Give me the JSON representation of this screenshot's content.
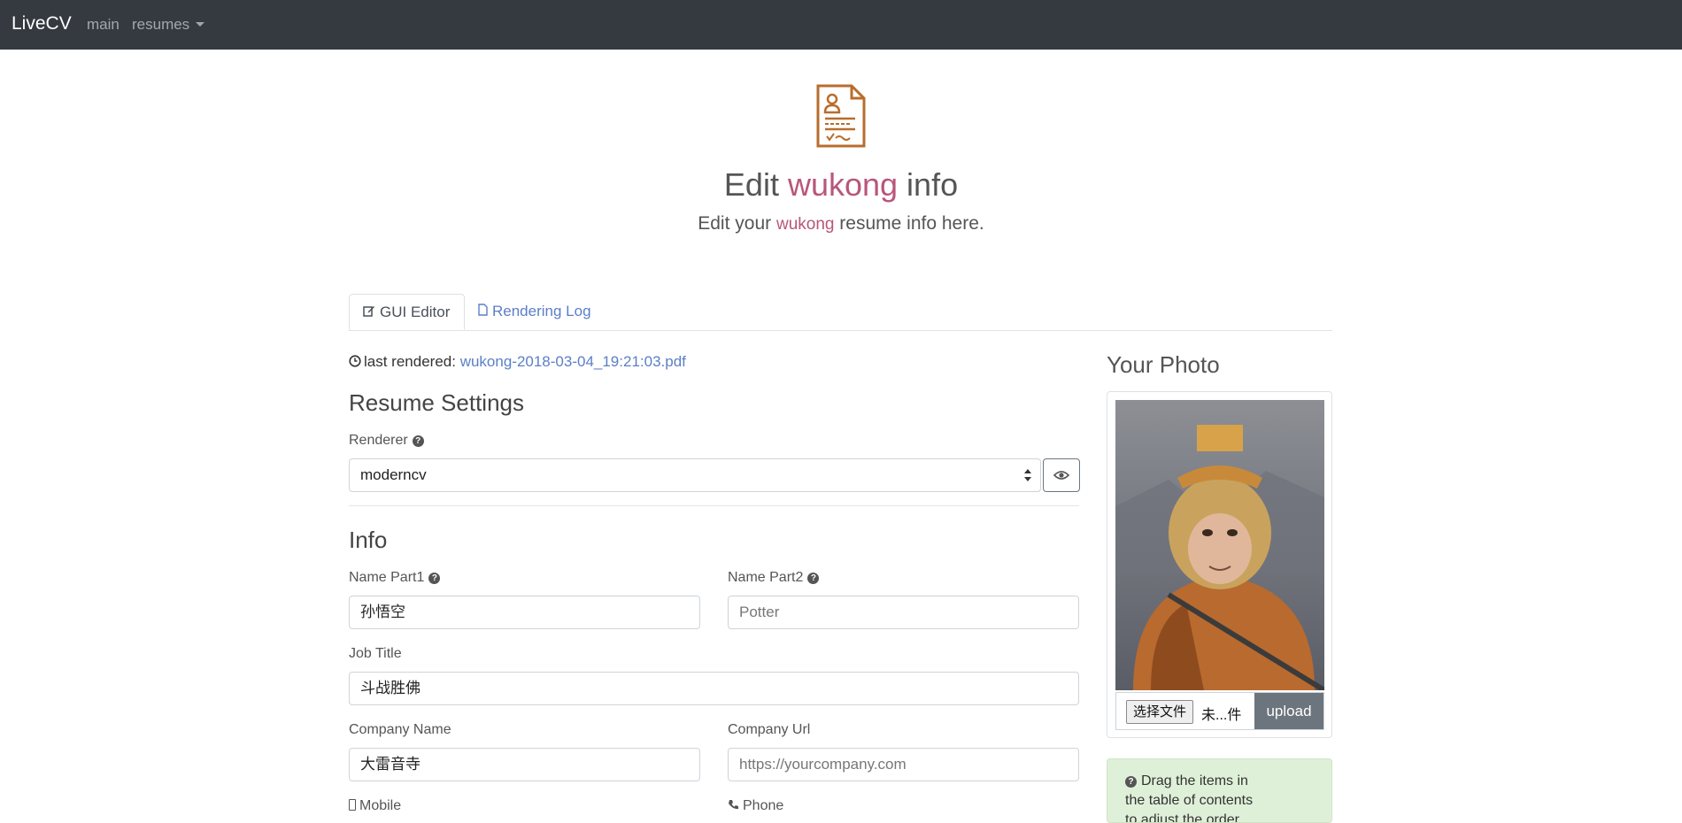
{
  "navbar": {
    "brand": "LiveCV",
    "links": [
      {
        "label": "main"
      },
      {
        "label": "resumes"
      }
    ]
  },
  "hero": {
    "icon": "resume-document-icon",
    "title_prefix": "Edit ",
    "title_accent": "wukong",
    "title_suffix": " info",
    "subtitle_prefix": "Edit your ",
    "subtitle_accent": "wukong",
    "subtitle_suffix": " resume info here.",
    "accent_color": "#b9567a"
  },
  "tabs": [
    {
      "label": "GUI Editor",
      "icon": "edit-icon",
      "active": true
    },
    {
      "label": "Rendering Log",
      "icon": "file-icon",
      "active": false
    }
  ],
  "last_rendered": {
    "label": "last rendered:",
    "file": "wukong-2018-03-04_19:21:03.pdf",
    "icon": "clock-icon"
  },
  "resume_settings": {
    "heading": "Resume Settings",
    "renderer_label": "Renderer",
    "renderer_value": "moderncv",
    "preview_icon": "eye-icon"
  },
  "info": {
    "heading": "Info",
    "name_part1": {
      "label": "Name Part1",
      "value": "孙悟空"
    },
    "name_part2": {
      "label": "Name Part2",
      "placeholder": "Potter"
    },
    "job_title": {
      "label": "Job Title",
      "value": "斗战胜佛"
    },
    "company_name": {
      "label": "Company Name",
      "value": "大雷音寺"
    },
    "company_url": {
      "label": "Company Url",
      "placeholder": "https://yourcompany.com"
    },
    "mobile": {
      "label": "Mobile",
      "icon": "mobile-icon"
    },
    "phone": {
      "label": "Phone",
      "icon": "phone-icon"
    }
  },
  "photo_panel": {
    "heading": "Your Photo",
    "choose_file": "选择文件",
    "file_name": "未...件",
    "upload": "upload"
  },
  "tip": {
    "icon": "question-circle-icon",
    "line1": "Drag the items in",
    "line2": "the table of contents",
    "line3": "to adjust the order."
  }
}
